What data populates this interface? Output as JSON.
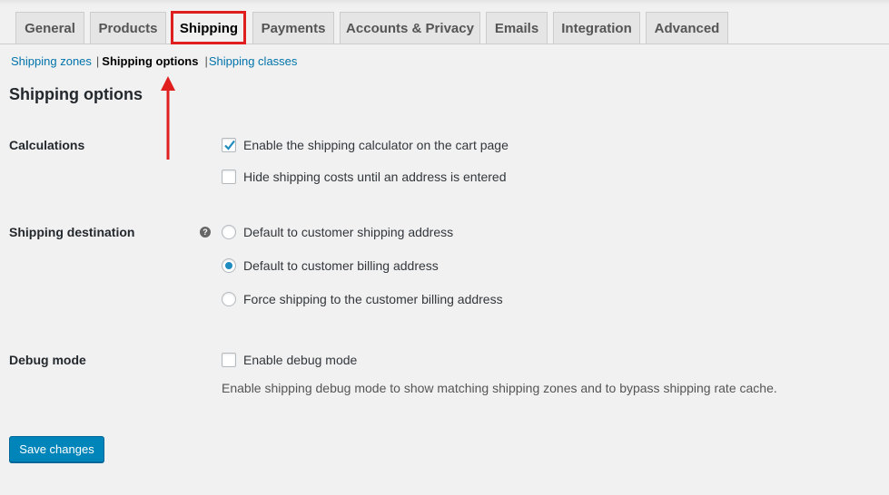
{
  "tabs": [
    {
      "label": "General"
    },
    {
      "label": "Products"
    },
    {
      "label": "Shipping"
    },
    {
      "label": "Payments"
    },
    {
      "label": "Accounts & Privacy"
    },
    {
      "label": "Emails"
    },
    {
      "label": "Integration"
    },
    {
      "label": "Advanced"
    }
  ],
  "active_tab": "Shipping",
  "subnav": {
    "items": [
      {
        "label": "Shipping zones"
      },
      {
        "label": "Shipping options"
      },
      {
        "label": "Shipping classes"
      }
    ],
    "separator": "|",
    "current": "Shipping options"
  },
  "page_title": "Shipping options",
  "calculations": {
    "label": "Calculations",
    "options": [
      {
        "label": "Enable the shipping calculator on the cart page",
        "checked": true
      },
      {
        "label": "Hide shipping costs until an address is entered",
        "checked": false
      }
    ]
  },
  "destination": {
    "label": "Shipping destination",
    "help_icon": "?",
    "options": [
      {
        "label": "Default to customer shipping address",
        "selected": false
      },
      {
        "label": "Default to customer billing address",
        "selected": true
      },
      {
        "label": "Force shipping to the customer billing address",
        "selected": false
      }
    ]
  },
  "debug": {
    "label": "Debug mode",
    "option": {
      "label": "Enable debug mode",
      "checked": false
    },
    "description": "Enable shipping debug mode to show matching shipping zones and to bypass shipping rate cache."
  },
  "save_button": "Save changes",
  "colors": {
    "accent": "#0085ba",
    "link": "#0073aa",
    "highlight": "#e01e1e"
  }
}
